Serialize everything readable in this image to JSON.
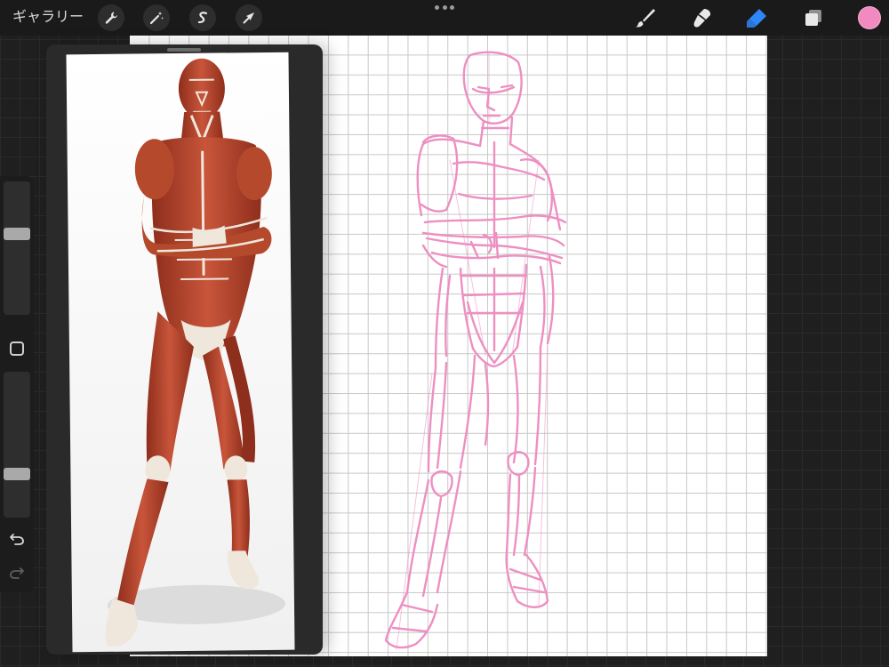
{
  "topbar": {
    "gallery_label": "ギャラリー",
    "actions_icon": "wrench-icon",
    "adjustments_icon": "magic-wand-icon",
    "selection_icon": "selection-s-icon",
    "transform_icon": "arrow-cursor-icon",
    "brush_icon": "brush-icon",
    "smudge_icon": "smudge-icon",
    "eraser_icon": "eraser-icon",
    "layers_icon": "layers-icon"
  },
  "colors": {
    "current_color": "#f08ac0",
    "eraser_active": "#2f86f6",
    "sketch_stroke": "#ee8fc2",
    "muscle": "#b4492c",
    "tendon": "#efe7dc"
  },
  "sidebar": {
    "brush_size_level": 0.38,
    "opacity_level": 0.72,
    "modify_icon": "modify-square-icon",
    "undo_icon": "undo-icon",
    "redo_icon": "redo-icon"
  },
  "reference": {
    "panel_icon": "reference-handle"
  }
}
